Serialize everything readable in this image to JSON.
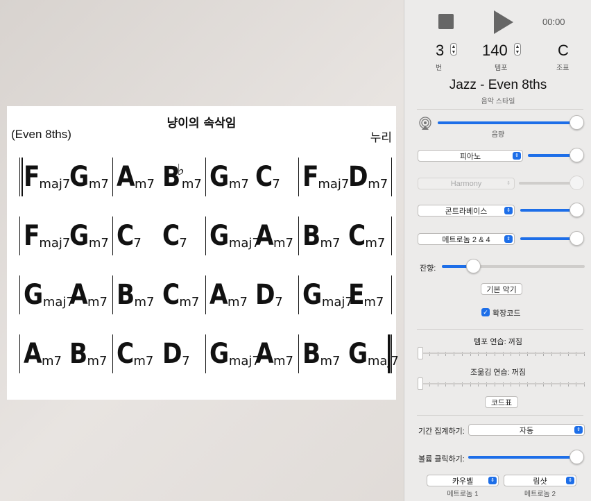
{
  "sheet": {
    "title": "냥이의 속삭임",
    "style": "(Even 8ths)",
    "composer": "누리",
    "rows": [
      [
        [
          {
            "root": "F",
            "qual": "maj7"
          },
          {
            "root": "G",
            "qual": "m7"
          }
        ],
        [
          {
            "root": "A",
            "qual": "m7"
          },
          {
            "root": "B",
            "acc": "♭",
            "qual": "m7"
          }
        ],
        [
          {
            "root": "G",
            "qual": "m7"
          },
          {
            "root": "C",
            "qual": "7"
          }
        ],
        [
          {
            "root": "F",
            "qual": "maj7"
          },
          {
            "root": "D",
            "qual": "m7"
          }
        ]
      ],
      [
        [
          {
            "root": "F",
            "qual": "maj7"
          },
          {
            "root": "G",
            "qual": "m7"
          }
        ],
        [
          {
            "root": "C",
            "qual": "7"
          },
          {
            "root": "C",
            "qual": "7"
          }
        ],
        [
          {
            "root": "G",
            "qual": "maj7"
          },
          {
            "root": "A",
            "qual": "m7"
          }
        ],
        [
          {
            "root": "B",
            "qual": "m7"
          },
          {
            "root": "C",
            "qual": "m7"
          }
        ]
      ],
      [
        [
          {
            "root": "G",
            "qual": "maj7"
          },
          {
            "root": "A",
            "qual": "m7"
          }
        ],
        [
          {
            "root": "B",
            "qual": "m7"
          },
          {
            "root": "C",
            "qual": "m7"
          }
        ],
        [
          {
            "root": "A",
            "qual": "m7"
          },
          {
            "root": "D",
            "qual": "7"
          }
        ],
        [
          {
            "root": "G",
            "qual": "maj7"
          },
          {
            "root": "E",
            "qual": "m7"
          }
        ]
      ],
      [
        [
          {
            "root": "A",
            "qual": "m7"
          },
          {
            "root": "B",
            "qual": "m7"
          }
        ],
        [
          {
            "root": "C",
            "qual": "m7"
          },
          {
            "root": "D",
            "qual": "7"
          }
        ],
        [
          {
            "root": "G",
            "qual": "maj7"
          },
          {
            "root": "A",
            "qual": "m7"
          }
        ],
        [
          {
            "root": "B",
            "qual": "m7"
          },
          {
            "root": "G",
            "qual": "maj7"
          }
        ]
      ]
    ]
  },
  "transport": {
    "time": "00:00",
    "chorus_value": "3",
    "chorus_label": "번",
    "tempo_value": "140",
    "tempo_label": "템포",
    "key_value": "C",
    "key_label": "조표"
  },
  "style": {
    "name": "Jazz - Even 8ths",
    "sub": "음악 스타일"
  },
  "mixer": {
    "volume_label": "음량",
    "volume": 1.0,
    "piano": "피아노",
    "piano_level": 1.0,
    "harmony": "Harmony",
    "harmony_level": 1.0,
    "bass": "콘트라베이스",
    "bass_level": 1.0,
    "drums": "메트로놈 2 & 4",
    "drums_level": 1.0,
    "reverb_label": "잔향:",
    "reverb": 0.22
  },
  "controls": {
    "default_instruments": "기본 악기",
    "extended_chords": "확장코드",
    "tempo_practice": "템포 연습: 꺼짐",
    "transpose_practice": "조옮김 연습: 꺼짐",
    "chord_chart": "코드표",
    "count_in_label": "기간 집계하기:",
    "count_in_value": "자동",
    "click_volume_label": "볼륨 클릭하기:",
    "click_volume": 1.0,
    "metronome1": "카우벨",
    "metronome1_label": "메트로놈 1",
    "metronome2": "림샷",
    "metronome2_label": "메트로놈 2"
  },
  "colors": {
    "accent": "#1d6ee8"
  }
}
